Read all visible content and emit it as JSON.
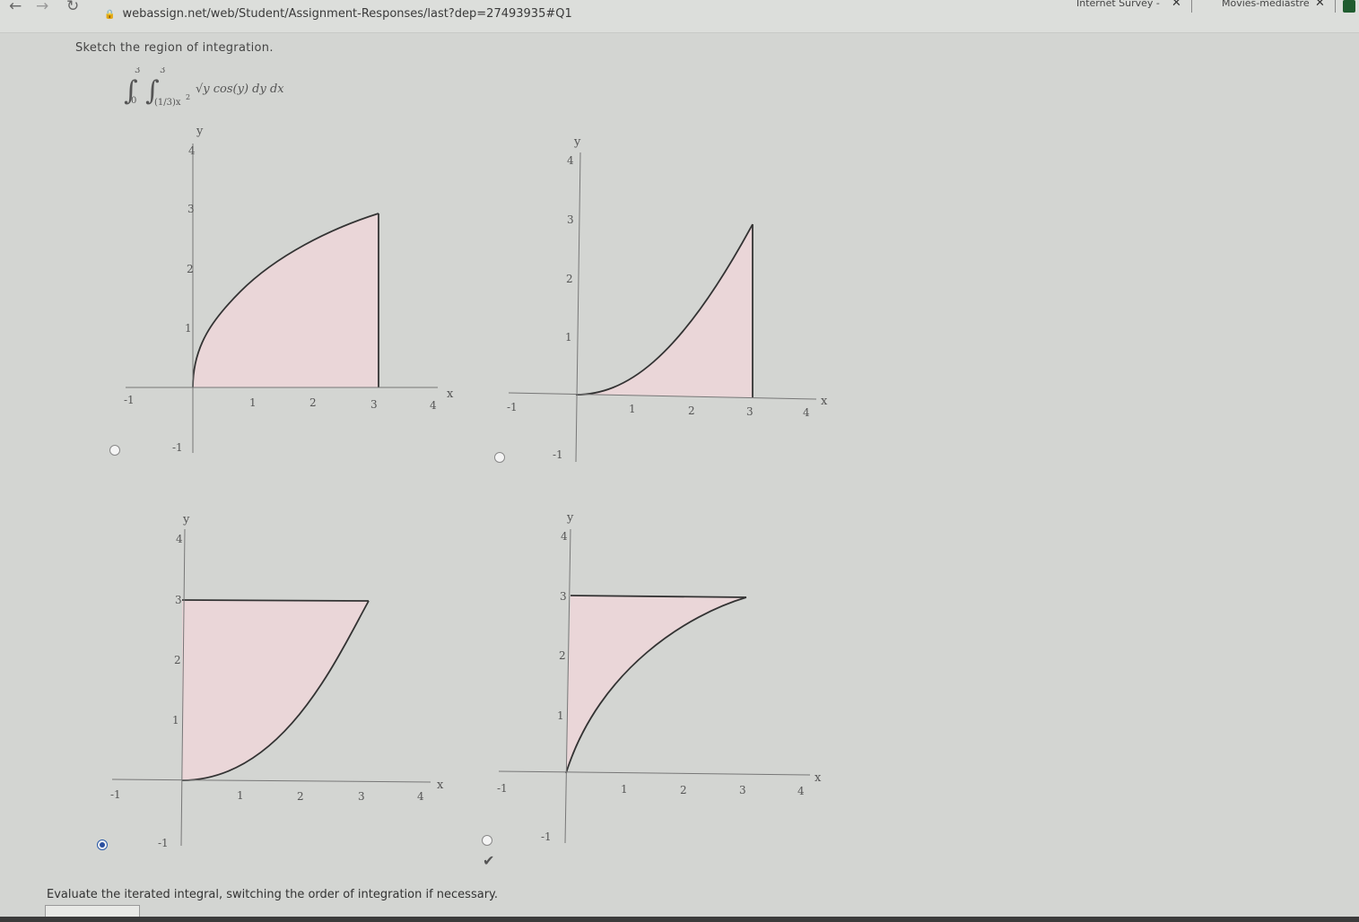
{
  "browser": {
    "url": "webassign.net/web/Student/Assignment-Responses/last?dep=27493935#Q1",
    "tabs": [
      "Internet Survey -",
      "Movies-mediastre"
    ]
  },
  "question": {
    "prompt": "Sketch the region of integration.",
    "integral": {
      "outer_lower": "0",
      "outer_upper": "3",
      "inner_lower": "(1/3)x",
      "inner_lower_exp": "2",
      "inner_upper": "3",
      "integrand": "√y cos(y) dy dx"
    }
  },
  "options": [
    {
      "id": "a",
      "selected": false,
      "description": "region under y = sqrt(3x) style curve from x=0 to x=3"
    },
    {
      "id": "b",
      "selected": false
    },
    {
      "id": "c",
      "selected": true
    },
    {
      "id": "d",
      "selected": false
    }
  ],
  "axis_labels": {
    "x": "x",
    "y": "y"
  },
  "tick_labels": {
    "neg": "-1",
    "t1": "1",
    "t2": "2",
    "t3": "3",
    "t4": "4"
  },
  "colors": {
    "region_fill": "#ead6d8",
    "curve": "#333333",
    "selected_radio": "#2a4fa0"
  },
  "footer": {
    "instruction": "Evaluate the iterated integral, switching the order of integration if necessary.",
    "check_icon": "check-icon"
  }
}
